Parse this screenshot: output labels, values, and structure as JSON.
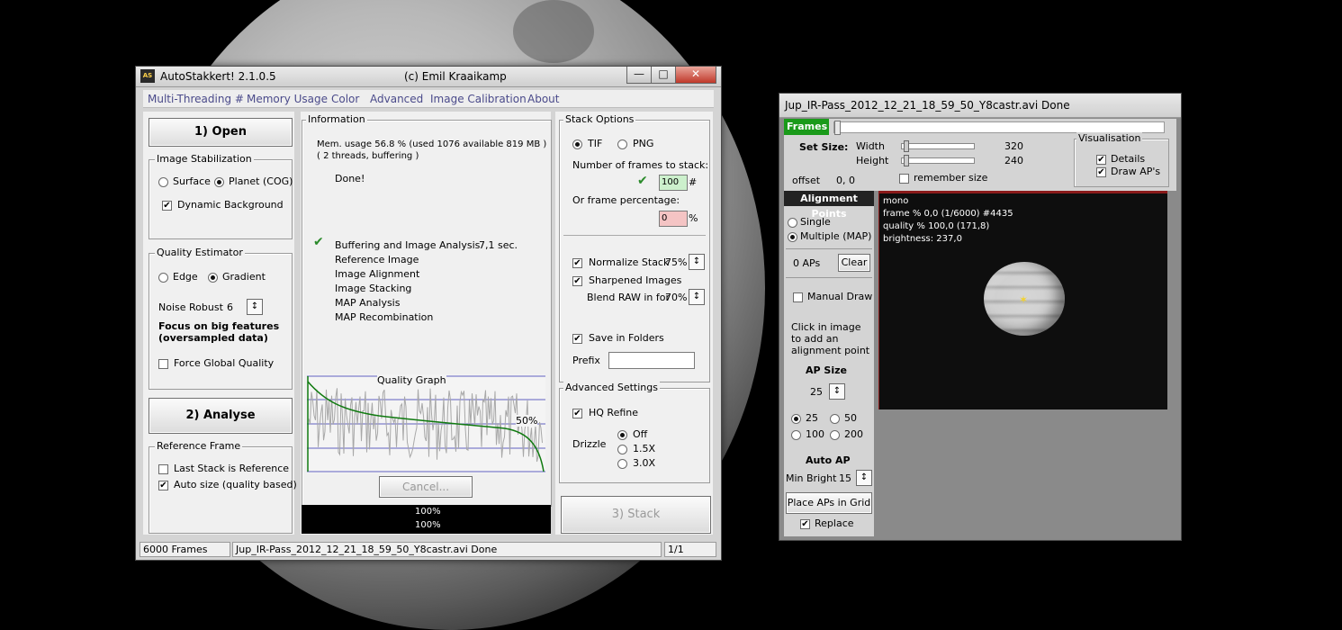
{
  "main": {
    "title": "AutoStakkert! 2.1.0.5",
    "copyright": "(c) Emil Kraaikamp",
    "menu": [
      "Multi-Threading #",
      "Memory Usage",
      "Color",
      "Advanced",
      "Image Calibration",
      "About"
    ],
    "open_button": "1) Open",
    "analyse_button": "2) Analyse",
    "stack_button": "3) Stack",
    "image_stabilization": {
      "label": "Image Stabilization",
      "surface": "Surface",
      "planet": "Planet (COG)",
      "dynamic_background": "Dynamic Background"
    },
    "quality_estimator": {
      "label": "Quality Estimator",
      "edge": "Edge",
      "gradient": "Gradient",
      "noise_robust_label": "Noise Robust",
      "noise_robust_value": "6",
      "focus_line1": "Focus on big features",
      "focus_line2": "(oversampled data)",
      "force_global": "Force Global Quality"
    },
    "reference_frame": {
      "label": "Reference Frame",
      "last_stack": "Last Stack is Reference",
      "auto_size": "Auto size (quality based)"
    },
    "information": {
      "label": "Information",
      "mem_line1": "Mem. usage 56.8 %  (used 1076 available 819 MB )",
      "mem_line2": "( 2 threads, buffering )",
      "done": "Done!",
      "steps": [
        {
          "label": "Buffering and Image Analysis",
          "time": "7,1 sec."
        },
        {
          "label": "Reference Image",
          "time": ""
        },
        {
          "label": "Image Alignment",
          "time": ""
        },
        {
          "label": "Image Stacking",
          "time": ""
        },
        {
          "label": "MAP Analysis",
          "time": ""
        },
        {
          "label": "MAP Recombination",
          "time": ""
        }
      ],
      "graph_title": "Quality Graph",
      "graph_percent": "50%",
      "cancel_button": "Cancel...",
      "progress1": "100%",
      "progress2": "100%"
    },
    "stack_options": {
      "label": "Stack Options",
      "tif": "TIF",
      "png": "PNG",
      "num_frames_label": "Number of frames to stack:",
      "num_frames_value": "100",
      "hash": "#",
      "frame_pct_label": "Or frame percentage:",
      "frame_pct_value": "0",
      "pct": "%",
      "normalize": "Normalize Stack",
      "normalize_value": "75%",
      "sharpened": "Sharpened Images",
      "blend_raw": "Blend RAW in for",
      "blend_value": "70%",
      "save_folders": "Save in Folders",
      "prefix_label": "Prefix",
      "prefix_value": ""
    },
    "advanced_settings": {
      "label": "Advanced Settings",
      "hq_refine": "HQ Refine",
      "drizzle_label": "Drizzle",
      "drizzle_off": "Off",
      "drizzle_15": "1.5X",
      "drizzle_30": "3.0X"
    },
    "status": {
      "frames": "6000 Frames",
      "file": "Jup_IR-Pass_2012_12_21_18_59_50_Y8castr.avi   Done",
      "page": "1/1"
    }
  },
  "preview": {
    "title": "Jup_IR-Pass_2012_12_21_18_59_50_Y8castr.avi   Done",
    "frames_label": "Frames",
    "set_size_label": "Set Size:",
    "width_label": "Width",
    "width_value": "320",
    "height_label": "Height",
    "height_value": "240",
    "offset_label": "offset",
    "offset_value": "0, 0",
    "remember_size": "remember size",
    "visualisation": {
      "label": "Visualisation",
      "details": "Details",
      "draw_aps": "Draw AP's"
    },
    "alignment_points": {
      "header": "Alignment Points",
      "single": "Single",
      "multiple": "Multiple (MAP)",
      "aps_count": "0 APs",
      "clear": "Clear",
      "manual_draw": "Manual Draw",
      "hint1": "Click in image",
      "hint2": "to add an",
      "hint3": "alignment point",
      "ap_size_label": "AP Size",
      "ap_size_value": "25",
      "sizes": [
        "25",
        "50",
        "100",
        "200"
      ],
      "auto_ap_label": "Auto AP",
      "min_bright_label": "Min Bright",
      "min_bright_value": "15",
      "place_grid": "Place APs in Grid",
      "replace": "Replace"
    },
    "overlay": {
      "line1": "mono",
      "line2": "frame % 0,0 (1/6000) #4435",
      "line3": "quality % 100,0  (171,8)",
      "line4": "brightness: 237,0"
    }
  }
}
